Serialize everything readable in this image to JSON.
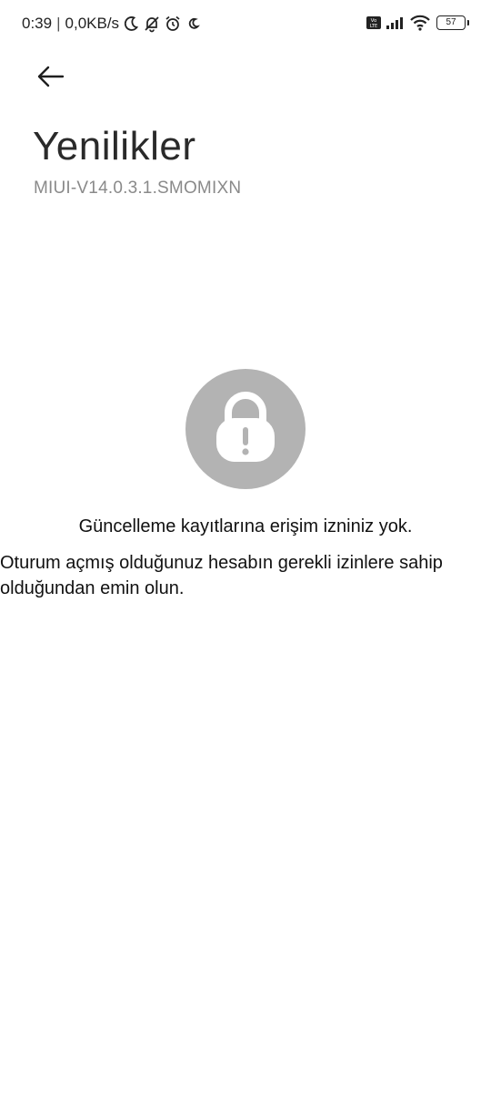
{
  "status_bar": {
    "time": "0:39",
    "separator": "|",
    "net_speed": "0,0KB/s",
    "battery": "57",
    "icons": [
      "moon-icon",
      "bell-off-icon",
      "alarm-icon",
      "moon-icon",
      "volte-icon",
      "signal-icon",
      "wifi-icon",
      "battery-icon"
    ]
  },
  "header": {
    "back_icon": "arrow-left-icon",
    "title": "Yenilikler",
    "version": "MIUI-V14.0.3.1.SMOMIXN"
  },
  "message": {
    "icon": "lock-warning-icon",
    "title": "Güncelleme kayıtlarına erişim izniniz yok.",
    "body": "Oturum açmış olduğunuz hesabın gerekli izinlere sahip olduğundan emin olun."
  },
  "colors": {
    "background": "#ffffff",
    "lock_circle": "#b3b3b3",
    "secondary_text": "#8a8a8a"
  }
}
